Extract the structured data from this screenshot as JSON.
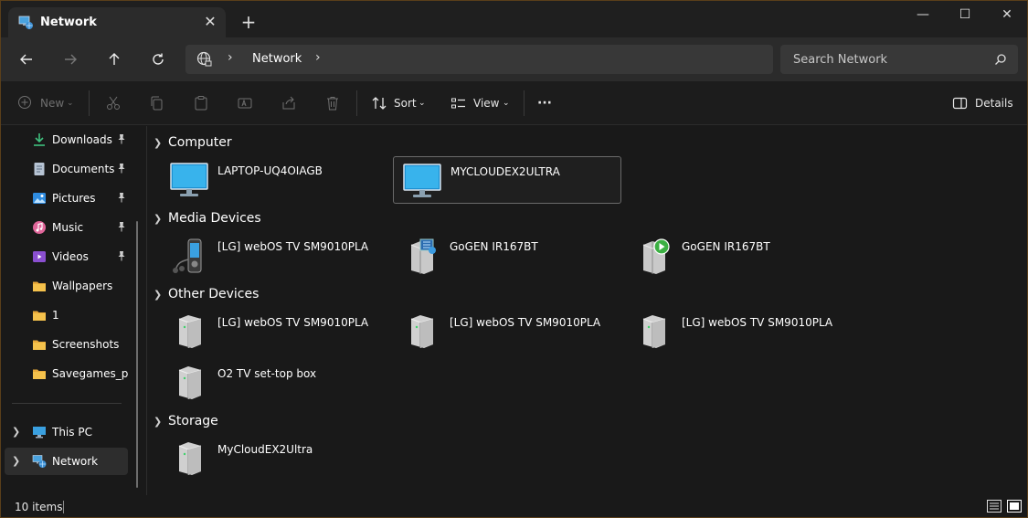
{
  "window": {
    "tab_title": "Network",
    "tab_close": "✕",
    "new_tab": "+",
    "minimize": "—",
    "maximize": "☐",
    "close": "✕"
  },
  "address": {
    "path": [
      "Network"
    ],
    "search_placeholder": "Search Network"
  },
  "toolbar": {
    "new_label": "New",
    "sort_label": "Sort",
    "view_label": "View",
    "more_label": "···",
    "details_label": "Details"
  },
  "sidebar": {
    "items": [
      {
        "label": "Downloads",
        "icon": "download-icon",
        "pinned": true
      },
      {
        "label": "Documents",
        "icon": "documents-icon",
        "pinned": true
      },
      {
        "label": "Pictures",
        "icon": "pictures-icon",
        "pinned": true
      },
      {
        "label": "Music",
        "icon": "music-icon",
        "pinned": true
      },
      {
        "label": "Videos",
        "icon": "videos-icon",
        "pinned": true
      },
      {
        "label": "Wallpapers",
        "icon": "folder-icon",
        "pinned": false
      },
      {
        "label": "1",
        "icon": "folder-icon",
        "pinned": false
      },
      {
        "label": "Screenshots",
        "icon": "folder-icon",
        "pinned": false
      },
      {
        "label": "Savegames_patch",
        "icon": "folder-icon",
        "pinned": false
      }
    ],
    "roots": [
      {
        "label": "This PC",
        "icon": "this-pc-icon"
      },
      {
        "label": "Network",
        "icon": "network-icon",
        "selected": true
      }
    ]
  },
  "groups": [
    {
      "title": "Computer",
      "items": [
        {
          "label": "LAPTOP-UQ4OIAGB",
          "icon": "monitor-icon"
        },
        {
          "label": "MYCLOUDEX2ULTRA",
          "icon": "monitor-icon",
          "selected": true
        }
      ]
    },
    {
      "title": "Media Devices",
      "items": [
        {
          "label": "[LG] webOS TV SM9010PLA",
          "icon": "media-player-icon"
        },
        {
          "label": "GoGEN IR167BT",
          "icon": "media-server-icon"
        },
        {
          "label": "GoGEN IR167BT",
          "icon": "media-renderer-icon"
        }
      ]
    },
    {
      "title": "Other Devices",
      "items": [
        {
          "label": "[LG] webOS TV SM9010PLA",
          "icon": "device-icon"
        },
        {
          "label": "[LG] webOS TV SM9010PLA",
          "icon": "device-icon"
        },
        {
          "label": "[LG] webOS TV SM9010PLA",
          "icon": "device-icon"
        },
        {
          "label": "O2 TV set-top box",
          "icon": "device-icon"
        }
      ]
    },
    {
      "title": "Storage",
      "items": [
        {
          "label": "MyCloudEX2Ultra",
          "icon": "device-icon"
        }
      ]
    }
  ],
  "status": {
    "count": "10 items"
  }
}
